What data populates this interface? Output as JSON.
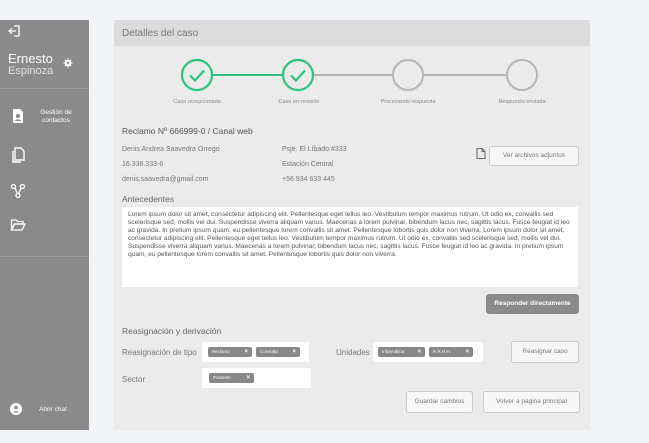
{
  "sidebar": {
    "first_name": "Ernesto",
    "last_name": "Espinoza",
    "nav_gestion": "Gestión de contactos",
    "chat_label": "Abrir chat"
  },
  "panel": {
    "title": "Detalles del caso"
  },
  "steps": [
    {
      "label": "Caso recepcionado",
      "done": true
    },
    {
      "label": "Caso en revisión",
      "done": true
    },
    {
      "label": "Procesando respuesta",
      "done": false
    },
    {
      "label": "Respuesta enviada",
      "done": false
    }
  ],
  "claim": {
    "title": "Reclamo Nº 666999-0 / Canal web",
    "name": "Denis Andrea Saavedra Orrego",
    "rut": "16.336.333-6",
    "email": "denis.saavedra@gmail.com",
    "address": "Psje. El Líbado #333",
    "station": "Estación Central",
    "phone": "+56 934 633 445",
    "attachments_button": "Ver archivos adjuntos"
  },
  "antecedentes": {
    "title": "Antecedentes",
    "text": "Lorem ipsum dolor sit amet, consectetur adipiscing elit. Pellentesque eget tellus leo. Vestibulum tempor maximus rutrum. Ut odio ex, convallis sed scelerisque sed, mollis vel dui. Suspendisse viverra aliquam varius. Maecenas a lorem pulvinar, bibendum lacus nec, sagittis lacus. Fusce feugiat id leo ac gravida. In pretium ipsum quam, eu pellentesque lorem convallis sit amet. Pellentesque lobortis quis dolor non viverra.  Lorem ipsum dolor sit amet, consectetur adipiscing elit. Pellentesque eget tellus leo. Vestibulum tempor maximus rutrum. Ut odio ex, convallis sed scelerisque sed, mollis vel dui. Suspendisse viverra aliquam varius. Maecenas a lorem pulvinar, bibendum lacus nec, sagittis lacus. Fusce feugiat id leo ac gravida. In pretium ipsum quam, eu pellentesque lorem convallis sit amet. Pellentesque lobortis quis dolor non viverra.",
    "reply_button": "Responder directamente"
  },
  "reasignacion": {
    "title": "Reasignación  y derivación",
    "tipo_label": "Reasignación de tipo",
    "tipo_chips": [
      "Reclamo",
      "Consulta"
    ],
    "unidades_label": "Unidades",
    "unidades_chips": [
      "Informática",
      "R.R.H.H."
    ],
    "reassign_button": "Reasignar caso",
    "sector_label": "Sector",
    "sector_chips": [
      "Poniente"
    ],
    "save_button": "Guardar cambios",
    "back_button": "Volver a página principal"
  },
  "colors": {
    "accent": "#2ec27e",
    "sidebar": "#8a8a8a",
    "inactive": "#b5b5b5"
  }
}
